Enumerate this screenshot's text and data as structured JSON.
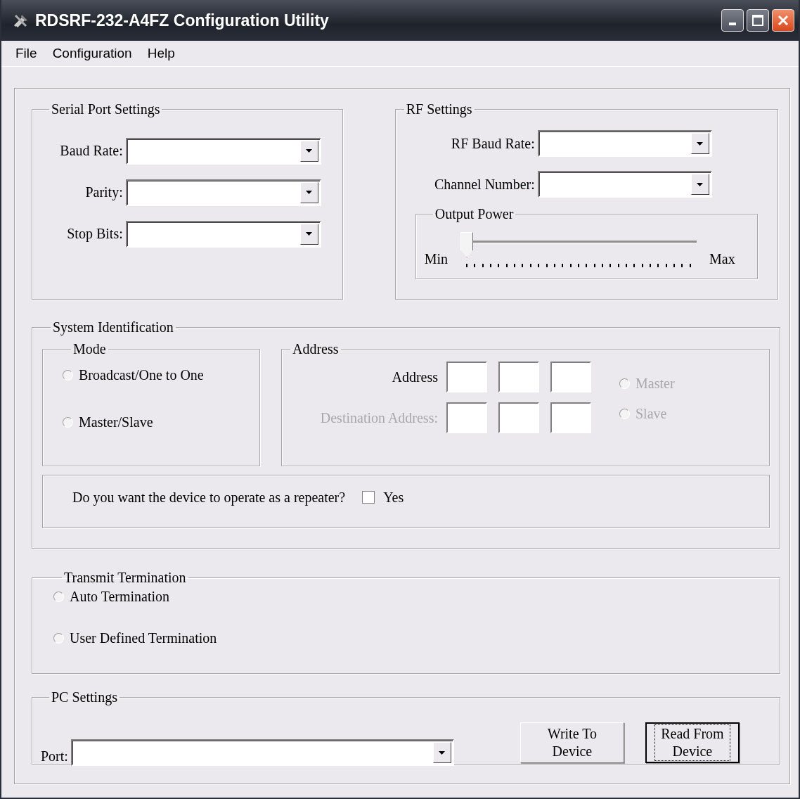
{
  "window": {
    "title": "RDSRF-232-A4FZ Configuration Utility"
  },
  "menu": [
    {
      "label": "File"
    },
    {
      "label": "Configuration"
    },
    {
      "label": "Help"
    }
  ],
  "serial_port_settings": {
    "title": "Serial Port Settings",
    "fields": [
      {
        "label": "Baud Rate:"
      },
      {
        "label": "Parity:"
      },
      {
        "label": "Stop Bits:"
      }
    ]
  },
  "rf_settings": {
    "title": "RF Settings",
    "fields": [
      {
        "label": "RF Baud Rate:"
      },
      {
        "label": "Channel Number:"
      }
    ],
    "output_power": {
      "title": "Output Power",
      "min_label": "Min",
      "max_label": "Max",
      "level": 0
    }
  },
  "system_identification": {
    "title": "System Identification",
    "mode": {
      "title": "Mode",
      "options": [
        {
          "label": "Broadcast/One to One",
          "selected": false
        },
        {
          "label": "Master/Slave",
          "selected": false
        }
      ]
    },
    "address": {
      "title": "Address",
      "rows": [
        {
          "label": "Address",
          "disabled": false
        },
        {
          "label": "Destination Address:",
          "disabled": true
        }
      ],
      "roles": [
        {
          "label": "Master",
          "selected": false,
          "disabled": true
        },
        {
          "label": "Slave",
          "selected": false,
          "disabled": true
        }
      ]
    },
    "repeater": {
      "question": "Do you want the device to operate as a repeater?",
      "checkbox_label": "Yes",
      "checked": false
    }
  },
  "transmit_termination": {
    "title": "Transmit Termination",
    "options": [
      {
        "label": "Auto Termination",
        "selected": false
      },
      {
        "label": "User Defined Termination",
        "selected": false
      }
    ]
  },
  "pc_settings": {
    "title": "PC Settings",
    "port_label": "Port:"
  },
  "buttons": [
    {
      "label": "Write To Device",
      "focused": false
    },
    {
      "label": "Read From Device",
      "focused": true
    }
  ]
}
